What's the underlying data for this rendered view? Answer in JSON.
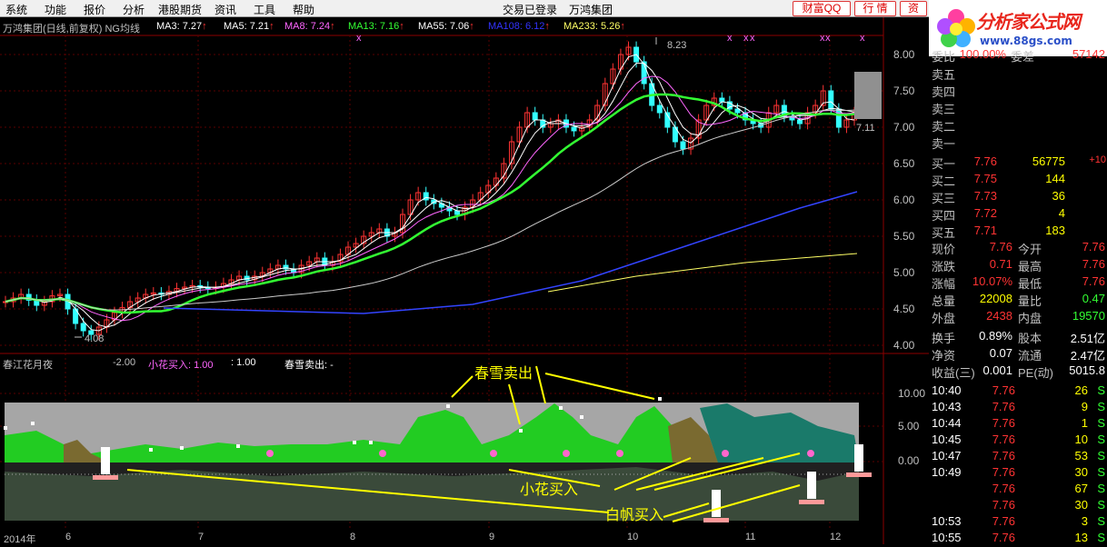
{
  "menubar": {
    "items": [
      "系统",
      "功能",
      "报价",
      "分析",
      "港股期货",
      "资讯",
      "工具",
      "帮助"
    ],
    "status": "交易已登录",
    "stock_name": "万鸿集团",
    "buttons": [
      "财富QQ",
      "行 情",
      "资"
    ]
  },
  "logo": {
    "title": "分析家公式网",
    "url": "www.88gs.com"
  },
  "main_chart": {
    "title": "万鸿集团(日线,前复权) NG均线",
    "ma": [
      {
        "label": "MA3: 7.27",
        "color": "#ffffff"
      },
      {
        "label": "MA5: 7.21",
        "color": "#ffffff"
      },
      {
        "label": "MA8: 7.24",
        "color": "#ff66ff"
      },
      {
        "label": "MA13: 7.16",
        "color": "#33ff33"
      },
      {
        "label": "MA55: 7.06",
        "color": "#ffffff"
      },
      {
        "label": "MA108: 6.12",
        "color": "#3333ff"
      },
      {
        "label": "MA233: 5.26",
        "color": "#ffff66"
      }
    ],
    "price_axis": [
      "8.00",
      "7.50",
      "7.00",
      "6.50",
      "6.00",
      "5.50",
      "5.00",
      "4.50",
      "4.00"
    ],
    "high_label": "8.23",
    "low_label": "4.08",
    "last_label": "7.11"
  },
  "indicator": {
    "name": "春江花月夜",
    "values": [
      {
        "label": "-2.00",
        "color": "#c0c0c0"
      },
      {
        "label": "小花买入: 1.00",
        "color": "#ff66ff"
      },
      {
        "label": ": 1.00",
        "color": "#ffffff"
      },
      {
        "label": "春雪卖出: -",
        "color": "#ffffff"
      }
    ],
    "axis": [
      "10.00",
      "5.00",
      "0.00"
    ],
    "annotations": {
      "sell": "春雪卖出",
      "small_flower_buy": "小花买入",
      "white_sail_buy": "白帆买入"
    }
  },
  "dates": [
    "2014年",
    "6",
    "7",
    "8",
    "9",
    "10",
    "11",
    "12"
  ],
  "right_panel": {
    "top_row": {
      "l1": "委比",
      "v1": "100.00%",
      "l2": "委差",
      "v2": "57142"
    },
    "asks": [
      {
        "label": "卖五",
        "price": "",
        "vol": ""
      },
      {
        "label": "卖四",
        "price": "",
        "vol": ""
      },
      {
        "label": "卖三",
        "price": "",
        "vol": ""
      },
      {
        "label": "卖二",
        "price": "",
        "vol": ""
      },
      {
        "label": "卖一",
        "price": "",
        "vol": ""
      }
    ],
    "bids": [
      {
        "label": "买一",
        "price": "7.76",
        "vol": "56775",
        "extra": "+10"
      },
      {
        "label": "买二",
        "price": "7.75",
        "vol": "144",
        "extra": ""
      },
      {
        "label": "买三",
        "price": "7.73",
        "vol": "36",
        "extra": ""
      },
      {
        "label": "买四",
        "price": "7.72",
        "vol": "4",
        "extra": ""
      },
      {
        "label": "买五",
        "price": "7.71",
        "vol": "183",
        "extra": ""
      }
    ],
    "stats": [
      {
        "l1": "现价",
        "v1": "7.76",
        "c1": "#ff3333",
        "l2": "今开",
        "v2": "7.76",
        "c2": "#ff3333"
      },
      {
        "l1": "涨跌",
        "v1": "0.71",
        "c1": "#ff3333",
        "l2": "最高",
        "v2": "7.76",
        "c2": "#ff3333"
      },
      {
        "l1": "涨幅",
        "v1": "10.07%",
        "c1": "#ff3333",
        "l2": "最低",
        "v2": "7.76",
        "c2": "#ff3333"
      },
      {
        "l1": "总量",
        "v1": "22008",
        "c1": "#ffff00",
        "l2": "量比",
        "v2": "0.47",
        "c2": "#33ff33"
      },
      {
        "l1": "外盘",
        "v1": "2438",
        "c1": "#ff3333",
        "l2": "内盘",
        "v2": "19570",
        "c2": "#33ff33"
      }
    ],
    "stats2": [
      {
        "l1": "换手",
        "v1": "0.89%",
        "l2": "股本",
        "v2": "2.51亿"
      },
      {
        "l1": "净资",
        "v1": "0.07",
        "l2": "流通",
        "v2": "2.47亿"
      },
      {
        "l1": "收益(三)",
        "v1": "0.001",
        "l2": "PE(动)",
        "v2": "5015.8"
      }
    ],
    "ticks": [
      {
        "time": "10:40",
        "price": "7.76",
        "vol": "26",
        "bs": "S"
      },
      {
        "time": "10:43",
        "price": "7.76",
        "vol": "9",
        "bs": "S"
      },
      {
        "time": "10:44",
        "price": "7.76",
        "vol": "1",
        "bs": "S"
      },
      {
        "time": "10:45",
        "price": "7.76",
        "vol": "10",
        "bs": "S"
      },
      {
        "time": "10:47",
        "price": "7.76",
        "vol": "53",
        "bs": "S"
      },
      {
        "time": "10:49",
        "price": "7.76",
        "vol": "30",
        "bs": "S"
      },
      {
        "time": "",
        "price": "7.76",
        "vol": "67",
        "bs": "S"
      },
      {
        "time": "",
        "price": "7.76",
        "vol": "30",
        "bs": "S"
      },
      {
        "time": "10:53",
        "price": "7.76",
        "vol": "3",
        "bs": "S"
      },
      {
        "time": "10:55",
        "price": "7.76",
        "vol": "13",
        "bs": "S"
      }
    ]
  }
}
